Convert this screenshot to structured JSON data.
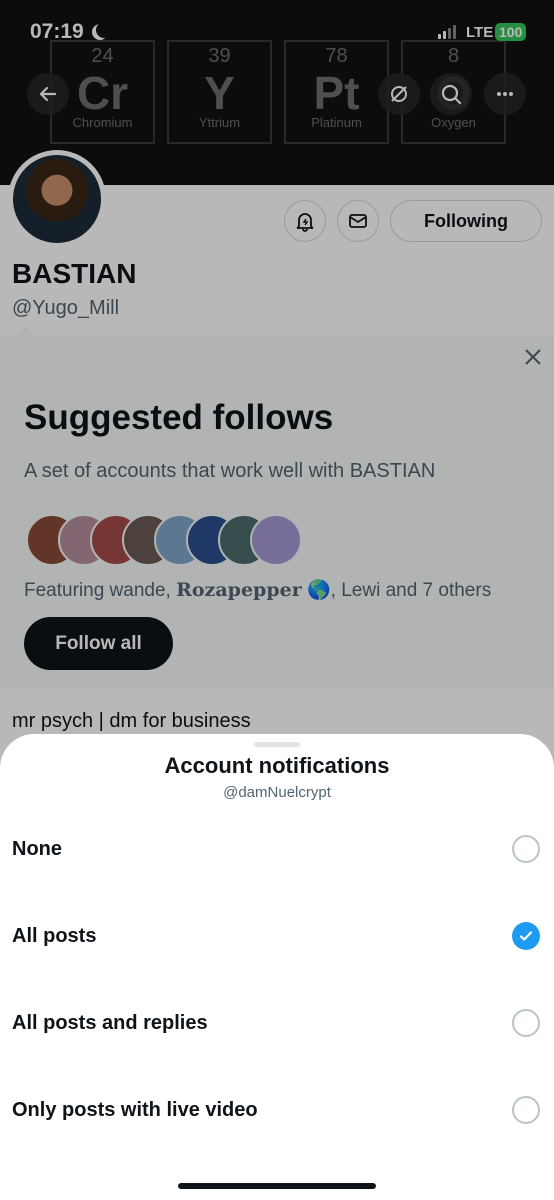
{
  "status_bar": {
    "time": "07:19",
    "network": "LTE",
    "battery": "100"
  },
  "banner": {
    "elements": [
      {
        "number": "24",
        "symbol": "Cr",
        "name": "Chromium"
      },
      {
        "number": "39",
        "symbol": "Y",
        "name": "Yttrium"
      },
      {
        "number": "78",
        "symbol": "Pt",
        "name": "Platinum"
      },
      {
        "number": "8",
        "symbol": "O",
        "name": "Oxygen"
      }
    ]
  },
  "profile": {
    "name": "BASTIAN",
    "handle": "@Yugo_Mill",
    "following_label": "Following",
    "bio": "mr psych | dm for business"
  },
  "suggested": {
    "title": "Suggested follows",
    "subtitle": "A set of accounts that work well with BASTIAN",
    "featuring_prefix": "Featuring wande, ",
    "featuring_bold": "Rozapepper",
    "featuring_emoji": "🌎",
    "featuring_suffix": ", Lewi and 7 others",
    "follow_all_label": "Follow all",
    "face_colors": [
      "#8a4a3a",
      "#b58fa0",
      "#a64b4b",
      "#6b5b55",
      "#7fa6c9",
      "#2b4f8f",
      "#4b6b6b",
      "#a69ad6"
    ]
  },
  "sheet": {
    "title": "Account notifications",
    "subtitle": "@damNuelcrypt",
    "options": [
      {
        "label": "None",
        "selected": false
      },
      {
        "label": "All posts",
        "selected": true
      },
      {
        "label": "All posts and replies",
        "selected": false
      },
      {
        "label": "Only posts with live video",
        "selected": false
      }
    ]
  },
  "colors": {
    "accent": "#1d9bf0",
    "text": "#0f1419",
    "muted": "#536471"
  }
}
